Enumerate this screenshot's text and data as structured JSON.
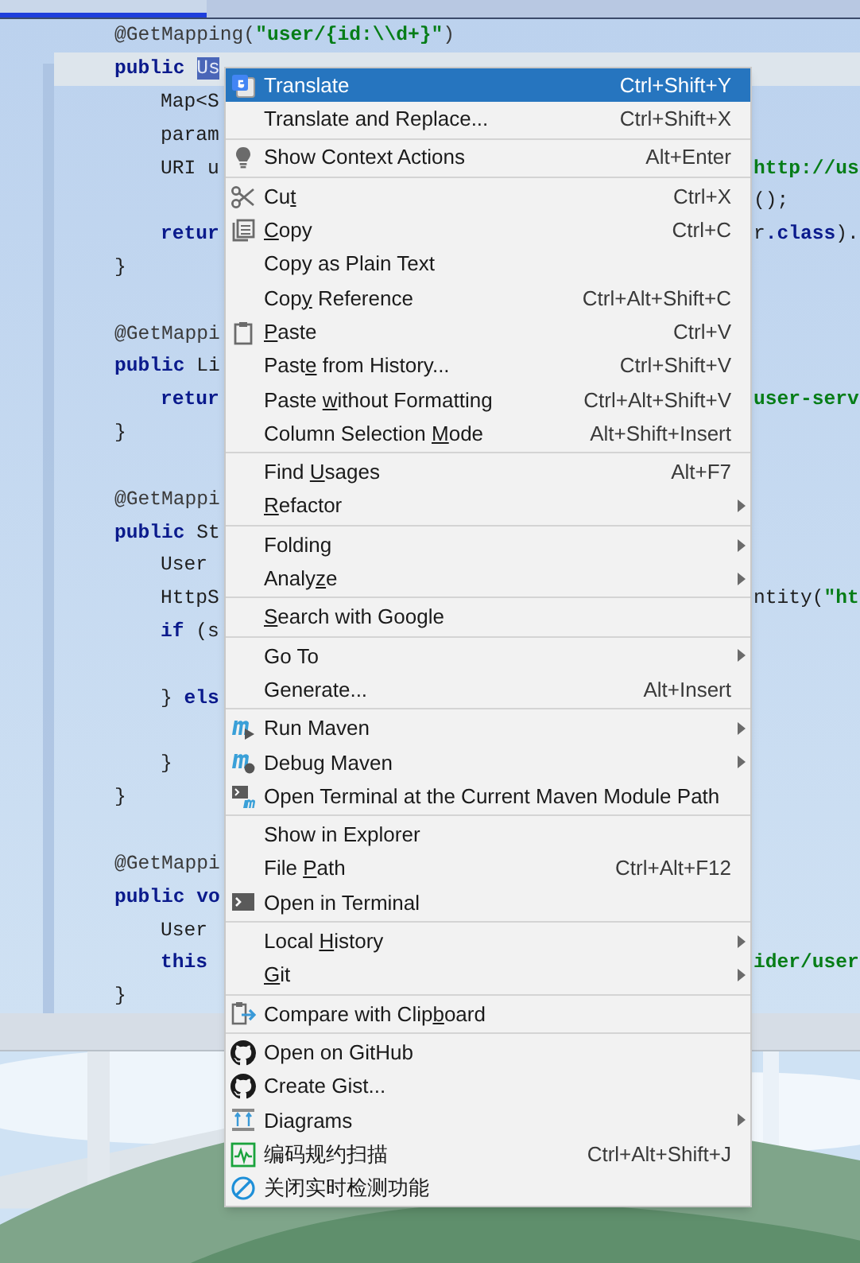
{
  "editor": {
    "lines": [
      {
        "kind": "code",
        "current": false,
        "indented": false,
        "left": [
          {
            "kind": "annotation",
            "text": "@GetMapping("
          },
          {
            "kind": "string",
            "text": "\"user/{id:\\\\d+}\""
          },
          {
            "kind": "annotation",
            "text": ")"
          }
        ]
      },
      {
        "kind": "code",
        "current": true,
        "indented": false,
        "left": [
          {
            "kind": "keyword",
            "text": "public "
          },
          {
            "kind": "selection",
            "text": "Us"
          }
        ]
      },
      {
        "kind": "code",
        "current": false,
        "indented": true,
        "left": [
          {
            "kind": "plain",
            "text": "Map<S"
          }
        ]
      },
      {
        "kind": "code",
        "current": false,
        "indented": true,
        "left": [
          {
            "kind": "plain",
            "text": "param"
          }
        ]
      },
      {
        "kind": "code",
        "current": false,
        "indented": true,
        "left": [
          {
            "kind": "plain",
            "text": "URI u"
          }
        ],
        "right": [
          {
            "kind": "string",
            "text": "http://us"
          }
        ]
      },
      {
        "kind": "code",
        "current": false,
        "right": [
          {
            "kind": "plain",
            "text": "();"
          }
        ]
      },
      {
        "kind": "code",
        "current": false,
        "indented": true,
        "left": [
          {
            "kind": "keyword",
            "text": "retur"
          }
        ],
        "right": [
          {
            "kind": "plain",
            "text": "r"
          },
          {
            "kind": "keyword",
            "text": ".class"
          },
          {
            "kind": "plain",
            "text": ")."
          }
        ]
      },
      {
        "kind": "code",
        "current": false,
        "indented": false,
        "left": [
          {
            "kind": "plain",
            "text": "}"
          }
        ]
      },
      {
        "kind": "blank"
      },
      {
        "kind": "code",
        "current": false,
        "indented": false,
        "left": [
          {
            "kind": "annotation",
            "text": "@GetMappi"
          }
        ]
      },
      {
        "kind": "code",
        "current": false,
        "indented": false,
        "left": [
          {
            "kind": "keyword",
            "text": "public "
          },
          {
            "kind": "plain",
            "text": "Li"
          }
        ]
      },
      {
        "kind": "code",
        "current": false,
        "indented": true,
        "left": [
          {
            "kind": "keyword",
            "text": "retur"
          }
        ],
        "right": [
          {
            "kind": "string",
            "text": "user-serv"
          }
        ]
      },
      {
        "kind": "code",
        "current": false,
        "indented": false,
        "left": [
          {
            "kind": "plain",
            "text": "}"
          }
        ]
      },
      {
        "kind": "blank"
      },
      {
        "kind": "code",
        "current": false,
        "indented": false,
        "left": [
          {
            "kind": "annotation",
            "text": "@GetMappi"
          }
        ]
      },
      {
        "kind": "code",
        "current": false,
        "indented": false,
        "left": [
          {
            "kind": "keyword",
            "text": "public "
          },
          {
            "kind": "plain",
            "text": "St"
          }
        ]
      },
      {
        "kind": "code",
        "current": false,
        "indented": true,
        "left": [
          {
            "kind": "plain",
            "text": "User"
          }
        ]
      },
      {
        "kind": "code",
        "current": false,
        "indented": true,
        "left": [
          {
            "kind": "plain",
            "text": "HttpS"
          }
        ],
        "right": [
          {
            "kind": "plain",
            "text": "ntity("
          },
          {
            "kind": "string",
            "text": "\"ht"
          }
        ]
      },
      {
        "kind": "code",
        "current": false,
        "indented": true,
        "left": [
          {
            "kind": "keyword",
            "text": "if"
          },
          {
            "kind": "plain",
            "text": " (s"
          }
        ]
      },
      {
        "kind": "blank"
      },
      {
        "kind": "code",
        "current": false,
        "indented": true,
        "left": [
          {
            "kind": "plain",
            "text": "} "
          },
          {
            "kind": "keyword",
            "text": "els"
          }
        ]
      },
      {
        "kind": "blank"
      },
      {
        "kind": "code",
        "current": false,
        "indented": true,
        "left": [
          {
            "kind": "plain",
            "text": "}"
          }
        ]
      },
      {
        "kind": "code",
        "current": false,
        "indented": false,
        "left": [
          {
            "kind": "plain",
            "text": "}"
          }
        ]
      },
      {
        "kind": "blank"
      },
      {
        "kind": "code",
        "current": false,
        "indented": false,
        "left": [
          {
            "kind": "annotation",
            "text": "@GetMappi"
          }
        ]
      },
      {
        "kind": "code",
        "current": false,
        "indented": false,
        "left": [
          {
            "kind": "keyword",
            "text": "public "
          },
          {
            "kind": "keyword",
            "text": "vo"
          }
        ]
      },
      {
        "kind": "code",
        "current": false,
        "indented": true,
        "left": [
          {
            "kind": "plain",
            "text": "User"
          }
        ]
      },
      {
        "kind": "code",
        "current": false,
        "indented": true,
        "left": [
          {
            "kind": "keyword",
            "text": "this"
          }
        ],
        "right": [
          {
            "kind": "string",
            "text": "ider/user"
          }
        ]
      },
      {
        "kind": "code",
        "current": false,
        "indented": false,
        "left": [
          {
            "kind": "plain",
            "text": "}"
          }
        ]
      }
    ]
  },
  "context_menu": {
    "sections": [
      [
        {
          "label": "Translate",
          "shortcut": "Ctrl+Shift+Y",
          "selected": true,
          "submenu": false
        },
        {
          "label": "Translate and Replace...",
          "shortcut": "Ctrl+Shift+X",
          "selected": false,
          "submenu": false
        }
      ],
      [
        {
          "label": "Show Context Actions",
          "shortcut": "Alt+Enter",
          "selected": false,
          "submenu": false
        }
      ],
      [
        {
          "label": "Cu",
          "mnemonic": "t",
          "shortcut": "Ctrl+X",
          "selected": false,
          "submenu": false
        },
        {
          "mnemonic": "C",
          "rest": "opy",
          "shortcut": "Ctrl+C",
          "selected": false,
          "submenu": false
        },
        {
          "label": "Copy as Plain Text",
          "selected": false,
          "submenu": false
        },
        {
          "label": "Cop",
          "mnemonic": "y",
          "rest": " Reference",
          "shortcut": "Ctrl+Alt+Shift+C",
          "selected": false,
          "submenu": false
        },
        {
          "mnemonic": "P",
          "rest": "aste",
          "shortcut": "Ctrl+V",
          "selected": false,
          "submenu": false
        },
        {
          "label": "Past",
          "mnemonic": "e",
          "rest": " from History...",
          "shortcut": "Ctrl+Shift+V",
          "selected": false,
          "submenu": false
        },
        {
          "label": "Paste ",
          "mnemonic": "w",
          "rest": "ithout Formatting",
          "shortcut": "Ctrl+Alt+Shift+V",
          "selected": false,
          "submenu": false
        },
        {
          "label": "Column Selection ",
          "mnemonic": "M",
          "rest": "ode",
          "shortcut": "Alt+Shift+Insert",
          "selected": false,
          "submenu": false
        }
      ],
      [
        {
          "label": "Find ",
          "mnemonic": "U",
          "rest": "sages",
          "shortcut": "Alt+F7",
          "selected": false,
          "submenu": false
        },
        {
          "mnemonic": "R",
          "rest": "efactor",
          "selected": false,
          "submenu": true
        }
      ],
      [
        {
          "label": "Folding",
          "selected": false,
          "submenu": true
        },
        {
          "label": "Analy",
          "mnemonic": "z",
          "rest": "e",
          "selected": false,
          "submenu": true
        }
      ],
      [
        {
          "mnemonic": "S",
          "rest": "earch with Google",
          "selected": false,
          "submenu": false
        }
      ],
      [
        {
          "label": "Go To",
          "selected": false,
          "submenu": true
        },
        {
          "label": "Generate...",
          "shortcut": "Alt+Insert",
          "selected": false,
          "submenu": false
        }
      ],
      [
        {
          "label": "Run Maven",
          "selected": false,
          "submenu": true
        },
        {
          "label": "Debug Maven",
          "selected": false,
          "submenu": true
        },
        {
          "label": "Open Terminal at the Current Maven Module Path",
          "selected": false,
          "submenu": false
        }
      ],
      [
        {
          "label": "Show in Explorer",
          "selected": false,
          "submenu": false
        },
        {
          "label": "File ",
          "mnemonic": "P",
          "rest": "ath",
          "shortcut": "Ctrl+Alt+F12",
          "selected": false,
          "submenu": false
        },
        {
          "label": "Open in Terminal",
          "selected": false,
          "submenu": false
        }
      ],
      [
        {
          "label": "Local ",
          "mnemonic": "H",
          "rest": "istory",
          "selected": false,
          "submenu": true
        },
        {
          "mnemonic": "G",
          "rest": "it",
          "selected": false,
          "submenu": true
        }
      ],
      [
        {
          "label": "Compare with Clip",
          "mnemonic": "b",
          "rest": "oard",
          "selected": false,
          "submenu": false
        }
      ],
      [
        {
          "label": "Open on GitHub",
          "selected": false,
          "submenu": false
        },
        {
          "label": "Create Gist...",
          "selected": false,
          "submenu": false
        },
        {
          "label": "Diagrams",
          "selected": false,
          "submenu": true
        },
        {
          "label": "编码规约扫描",
          "shortcut": "Ctrl+Alt+Shift+J",
          "selected": false,
          "submenu": false
        },
        {
          "label": "关闭实时检测功能",
          "selected": false,
          "submenu": false
        }
      ]
    ]
  }
}
